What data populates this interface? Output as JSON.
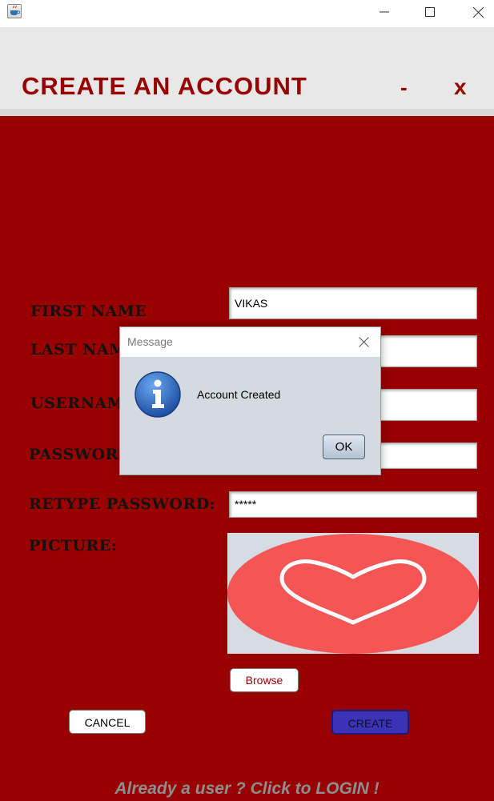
{
  "window": {
    "icon": "java-app-icon",
    "controls": [
      "minimize-icon",
      "maximize-icon",
      "close-icon"
    ]
  },
  "header": {
    "title": "CREATE AN ACCOUNT",
    "minimize_label": "-",
    "close_label": "x"
  },
  "form": {
    "first_name": {
      "label": "FIRST NAME",
      "value": "VIKAS"
    },
    "last_name": {
      "label": "LAST NAM",
      "value": ""
    },
    "username": {
      "label": "USERNAM",
      "value": ""
    },
    "password": {
      "label": "PASSWORI",
      "value": ""
    },
    "retype_password": {
      "label": "RETYPE PASSWORD:",
      "value": "*****"
    },
    "picture": {
      "label": "PICTURE:",
      "image": "heart-picture"
    },
    "browse_label": "Browse",
    "cancel_label": "CANCEL",
    "create_label": "CREATE",
    "login_link": "Already a user ? Click to LOGIN !"
  },
  "dialog": {
    "title": "Message",
    "message": "Account Created",
    "ok_label": "OK",
    "icon": "info-icon"
  },
  "colors": {
    "background": "#990000",
    "title_text": "#990000",
    "create_button": "#3b32b5",
    "link_text": "#8c8f8f",
    "dialog_body": "#d5d9e0"
  }
}
